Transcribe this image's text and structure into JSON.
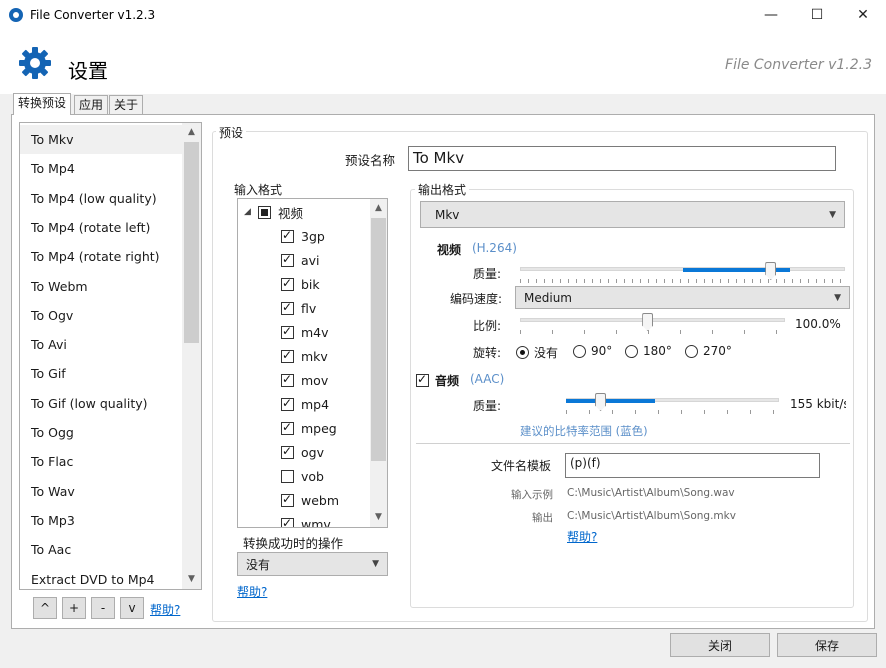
{
  "window": {
    "title": "File Converter v1.2.3",
    "minimize": "—",
    "maximize": "☐",
    "close": "✕"
  },
  "header": {
    "title": "设置",
    "version": "File Converter v1.2.3",
    "icon": "gear-icon",
    "accent": "#1464b4"
  },
  "tabs": [
    {
      "label": "转换预设",
      "active": true
    },
    {
      "label": "应用",
      "active": false
    },
    {
      "label": "关于",
      "active": false
    }
  ],
  "presets": {
    "selected_index": 0,
    "items": [
      "To Mkv",
      "To Mp4",
      "To Mp4 (low quality)",
      "To Mp4 (rotate left)",
      "To Mp4 (rotate right)",
      "To Webm",
      "To Ogv",
      "To Avi",
      "To Gif",
      "To Gif (low quality)",
      "To Ogg",
      "To Flac",
      "To Wav",
      "To Mp3",
      "To Aac",
      "Extract DVD to Mp4"
    ],
    "buttons": [
      "^",
      "+",
      "-",
      "v"
    ],
    "help": "帮助?"
  },
  "preset": {
    "group_label": "预设",
    "name_label": "预设名称",
    "name_value": "To Mkv"
  },
  "input_formats": {
    "label": "输入格式",
    "category": "视频",
    "category_state": "partial",
    "formats": [
      {
        "name": "3gp",
        "checked": true
      },
      {
        "name": "avi",
        "checked": true
      },
      {
        "name": "bik",
        "checked": true
      },
      {
        "name": "flv",
        "checked": true
      },
      {
        "name": "m4v",
        "checked": true
      },
      {
        "name": "mkv",
        "checked": true
      },
      {
        "name": "mov",
        "checked": true
      },
      {
        "name": "mp4",
        "checked": true
      },
      {
        "name": "mpeg",
        "checked": true
      },
      {
        "name": "ogv",
        "checked": true
      },
      {
        "name": "vob",
        "checked": false
      },
      {
        "name": "webm",
        "checked": true
      },
      {
        "name": "wmv",
        "checked": true
      }
    ],
    "on_success_label": "转换成功时的操作",
    "on_success_value": "没有",
    "help": "帮助?"
  },
  "output": {
    "label": "输出格式",
    "format": "Mkv",
    "video": {
      "label": "视频",
      "codec": "(H.264)",
      "quality_label": "质量:",
      "quality_level": 0.77,
      "recommended_range": [
        0.5,
        0.83
      ],
      "speed_label": "编码速度:",
      "speed_value": "Medium",
      "scale_label": "比例:",
      "scale_value": "100.0%",
      "scale_level": 0.48,
      "rotate_label": "旋转:",
      "rotate_options": [
        "没有",
        "90°",
        "180°",
        "270°"
      ],
      "rotate_selected": 0
    },
    "audio": {
      "enabled": true,
      "label": "音频",
      "codec": "(AAC)",
      "quality_label": "质量:",
      "quality_value": "155 kbit/s",
      "quality_level": 0.16,
      "recommended_range": [
        0.0,
        0.42
      ],
      "recommended_note": "建议的比特率范围 (蓝色)"
    },
    "filename_template_label": "文件名模板",
    "filename_template_value": "(p)(f)",
    "example_input_label": "输入示例",
    "example_input_value": "C:\\Music\\Artist\\Album\\Song.wav",
    "example_output_label": "输出",
    "example_output_value": "C:\\Music\\Artist\\Album\\Song.mkv",
    "help": "帮助?"
  },
  "footer": {
    "close": "关闭",
    "save": "保存"
  }
}
